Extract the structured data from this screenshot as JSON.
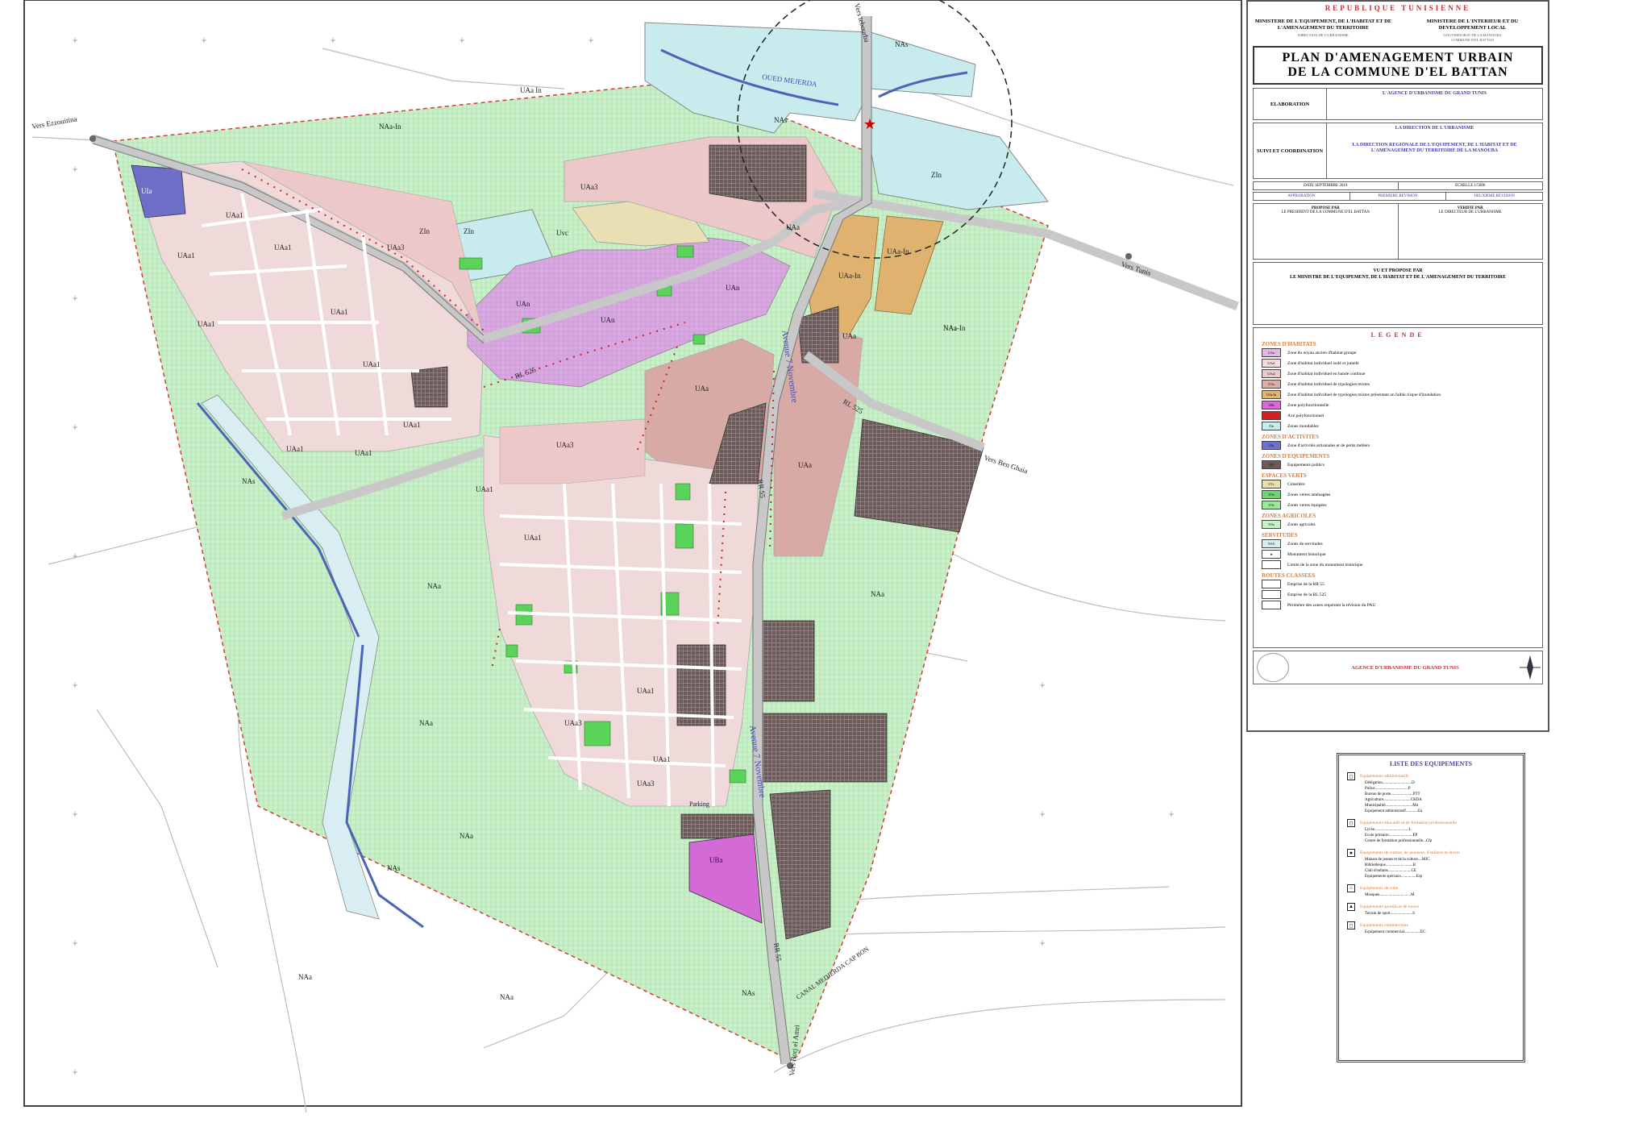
{
  "cartouche": {
    "country": "REPUBLIQUE TUNISIENNE",
    "ministry_left": "MINISTERE DE L'EQUIPEMENT, DE L'HABITAT ET DE L'AMENAGEMENT DU TERRITOIRE",
    "ministry_right": "MINISTERE DE L'INTERIEUR ET DU DEVELOPPEMENT LOCAL",
    "sub_left": "DIRECTION DE L'URBANISME",
    "sub_right": "GOUVERNORAT DE LA MANOUBA",
    "sub_right2": "COMMUNE D'EL BATTAN",
    "title_line1": "PLAN D'AMENAGEMENT URBAIN",
    "title_line2": "DE LA COMMUNE D'EL BATTAN",
    "elaboration_label": "ELABORATION",
    "elaboration_org": "L'AGENCE D'URBANISME DU GRAND TUNIS",
    "suivi_label": "SUIVI ET COORDINATION",
    "suivi_org1": "LA DIRECTION DE L'URBANISME",
    "suivi_org2": "LA DIRECTION REGIONALE DE L'EQUIPEMENT, DE L'HABITAT ET DE L'AMENAGEMENT DU TERRITOIRE DE LA MANOUBA",
    "date_label": "DATE",
    "date_value": "SEPTEMBRE 2019",
    "scale_label": "ECHELLE",
    "scale_value": "1/5000",
    "approbation": "APPROBATION",
    "premiere_revision": "PREMIERE REVISION",
    "deuxieme_revision": "DEUXIEME REVISION",
    "propose_par": "PROPOSE PAR",
    "propose_val": "LE PRESIDENT DE LA COMMUNE D'EL BATTAN",
    "verifie_par": "VERIFIE PAR",
    "verifie_val": "LE DIRECTEUR DE L'URBANISME",
    "vu_title": "VU ET PROPOSE PAR",
    "vu_val": "LE MINISTRE DE L'EQUIPEMENT, DE L'HABITAT ET DE L'AMENAGEMENT DU TERRITOIRE",
    "agency": "AGENCE D'URBANISME DU GRAND TUNIS"
  },
  "legend": {
    "title": "LEGENDE",
    "sec_habitat": "ZONES D'HABITATS",
    "habitat": [
      {
        "code": "UAn",
        "label": "Zone du noyau ancien d'habitat groupé",
        "color": "#e4b7e6"
      },
      {
        "code": "UAa1",
        "label": "Zone d'habitat individuel isolé et jumelé",
        "color": "#f2dede"
      },
      {
        "code": "UAa2",
        "label": "Zone d'habitat individuel en bande continue",
        "color": "#edc8c8"
      },
      {
        "code": "UAa",
        "label": "Zone d'habitat individuel de typologies mixtes",
        "color": "#d9b0a8"
      },
      {
        "code": "UAa-In",
        "label": "Zone d'habitat individuel de typologies mixtes présentant un faible risque d'inondation",
        "color": "#e6b36a"
      },
      {
        "code": "UBa",
        "label": "Zone polyfonctionnelle",
        "color": "#d86ad8"
      },
      {
        "code": "",
        "label": "Axe polyfonctionnel",
        "color": "#d02020"
      },
      {
        "code": "ZIn",
        "label": "Zones inondables",
        "color": "#c6ecec"
      }
    ],
    "sec_activites": "ZONES D'ACTIVITES",
    "activites": [
      {
        "code": "UIa",
        "label": "Zone d'activités artisanales et de petits métiers",
        "color": "#7070c8"
      }
    ],
    "sec_equip": "ZONES D'EQUIPEMENTS",
    "equip": [
      {
        "code": "UE",
        "label": "Equipements publics",
        "color": "#6a5a5a"
      }
    ],
    "sec_verts": "ESPACES VERTS",
    "verts": [
      {
        "code": "UVc",
        "label": "Cimetière",
        "color": "#e6e0b0"
      },
      {
        "code": "UVa",
        "label": "Zones vertes aménagées",
        "color": "#6ad86a"
      },
      {
        "code": "UVe",
        "label": "Zones vertes équipées",
        "color": "#9ae89a"
      }
    ],
    "sec_agri": "ZONES AGRICOLES",
    "agri": [
      {
        "code": "NAa",
        "label": "Zones agricoles",
        "color": "#c9f0c9"
      }
    ],
    "sec_serv": "SERVITUDES",
    "serv": [
      {
        "code": "NAS",
        "label": "Zones de servitudes",
        "color": "#d8eef2"
      },
      {
        "code": "★",
        "label": "Monument historique",
        "color": "#ffffff"
      },
      {
        "code": "",
        "label": "Limite de la zone du monument historique",
        "color": "#ffffff"
      }
    ],
    "sec_routes": "ROUTES CLASSEES",
    "routes": [
      {
        "code": "",
        "label": "Emprise de la RR 55",
        "color": "#ffffff"
      },
      {
        "code": "",
        "label": "Emprise de la RL 525",
        "color": "#ffffff"
      },
      {
        "code": "",
        "label": "Périmètre des zones requérant la révision du PAU",
        "color": "#ffffff"
      }
    ]
  },
  "equipements": {
    "title": "LISTE DES EQUIPEMENTS",
    "groups": [
      {
        "label": "Equipements administratifs",
        "items": [
          "Délégation.............................D",
          "Police.................................P",
          "Bureau de poste......................PTT",
          "Agriculture...........................CRDA",
          "Municipalité...........................Mu",
          "Equipement administratif............Ea"
        ]
      },
      {
        "label": "Equipements éducatifs et de formation professionnelle",
        "items": [
          "Lycée..................................L",
          "Ecole primaire........................EP",
          "Centre de formation professionnelle...Cfp"
        ]
      },
      {
        "label": "Equipements de culture, de jeunesse, d'enfance et divers",
        "items": [
          "Maison de jeunes et de la culture....MJC",
          "Bibliothèque...........................B",
          "Club d'enfants.......................CE",
          "Equipements spéciaux...............Esp"
        ]
      },
      {
        "label": "Equipements de culte",
        "items": [
          "Mosquée...............................M"
        ]
      },
      {
        "label": "Equipements sportifs et de loisirs",
        "items": [
          "Terrain de sport......................S"
        ]
      },
      {
        "label": "Equipements commerciaux",
        "items": [
          "Equipement commercial................EC"
        ]
      }
    ]
  },
  "map_labels": {
    "oued": "OUED MEJERDA",
    "vers_ezzouitina": "Vers Ezzouitina",
    "vers_tunis": "Vers Tunis",
    "vers_tebourba": "Vers tebourba",
    "vers_ben_ghaia": "Vers Ben Ghaia",
    "vers_borj": "Vers Borj el Amri",
    "avenue": "Avenue 7 Novembre",
    "canal": "CANAL MEDJERDA CAP BON",
    "rl525": "RL 525",
    "rr55": "RR 55",
    "parking": "Parking"
  },
  "map_colors": {
    "agri": "#c9f0c9",
    "habitat_light": "#f0d9d9",
    "habitat_mixed": "#d8aaa5",
    "uan": "#d8a8e0",
    "equip": "#6b5a5a",
    "flood": "#c8ecee",
    "uba": "#d36ad6",
    "uaa_in": "#e0b270",
    "uia": "#6e6ec8",
    "uva": "#5bd35b",
    "road": "#dcdcdc"
  }
}
